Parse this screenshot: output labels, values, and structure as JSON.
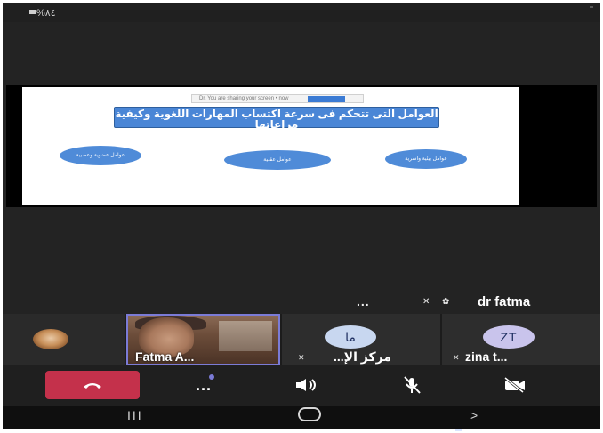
{
  "status_bar": {
    "text": "%٨٤"
  },
  "shared_screen": {
    "slide": {
      "toolbar_text": "Dr. You are sharing your screen • now",
      "title": "العوامل التى تتحكم فى سرعة اكتساب المهارات اللغوية وكيفية مراعاتها",
      "ovals": [
        "عوامل عضوية وعصبية",
        "عوامل عقلية",
        "عوامل بيئية واسرية"
      ]
    }
  },
  "presenter": {
    "more_label": "...",
    "name": "dr fatma"
  },
  "participants": [
    {
      "name": ""
    },
    {
      "name": "Fatma A..."
    },
    {
      "initials": "ما",
      "name": "مركز الإ..."
    },
    {
      "initials": "ZT",
      "name": "zina t..."
    }
  ],
  "controls": {
    "more_label": "...",
    "hangup_icon": "phone-hangup-icon",
    "speaker_icon": "speaker-icon",
    "mic_icon": "mic-off-icon",
    "camera_icon": "camera-off-icon"
  },
  "nav": {
    "recent_label": "III",
    "back_label": ">"
  },
  "colors": {
    "hangup": "#c4314b",
    "active_tile_border": "#7b7bd6",
    "slide_accent": "#4a86d6"
  }
}
